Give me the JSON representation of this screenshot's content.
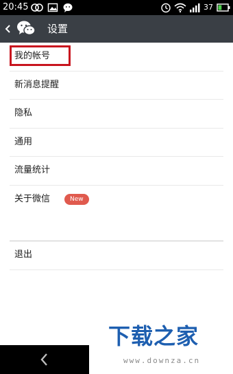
{
  "status_bar": {
    "time": "20:45",
    "battery_percent": "37",
    "icons": [
      "circles-icon",
      "image-icon",
      "wechat-icon",
      "alarm-icon",
      "wifi-icon",
      "signal-icon",
      "battery-icon"
    ],
    "battery_level": 0.37
  },
  "action_bar": {
    "title": "设置",
    "logo": "wechat-logo"
  },
  "settings": {
    "items": [
      {
        "label": "我的帐号"
      },
      {
        "label": "新消息提醒"
      },
      {
        "label": "隐私"
      },
      {
        "label": "通用"
      },
      {
        "label": "流量统计"
      },
      {
        "label": "关于微信",
        "badge": "New"
      }
    ],
    "logout": {
      "label": "退出"
    }
  },
  "watermark": {
    "text": "下载之家",
    "url": "www.downza.cn"
  },
  "colors": {
    "action_bar": "#3a3f45",
    "highlight": "#c8141e",
    "badge": "#e05a4e",
    "watermark": "#1e5fb0"
  }
}
